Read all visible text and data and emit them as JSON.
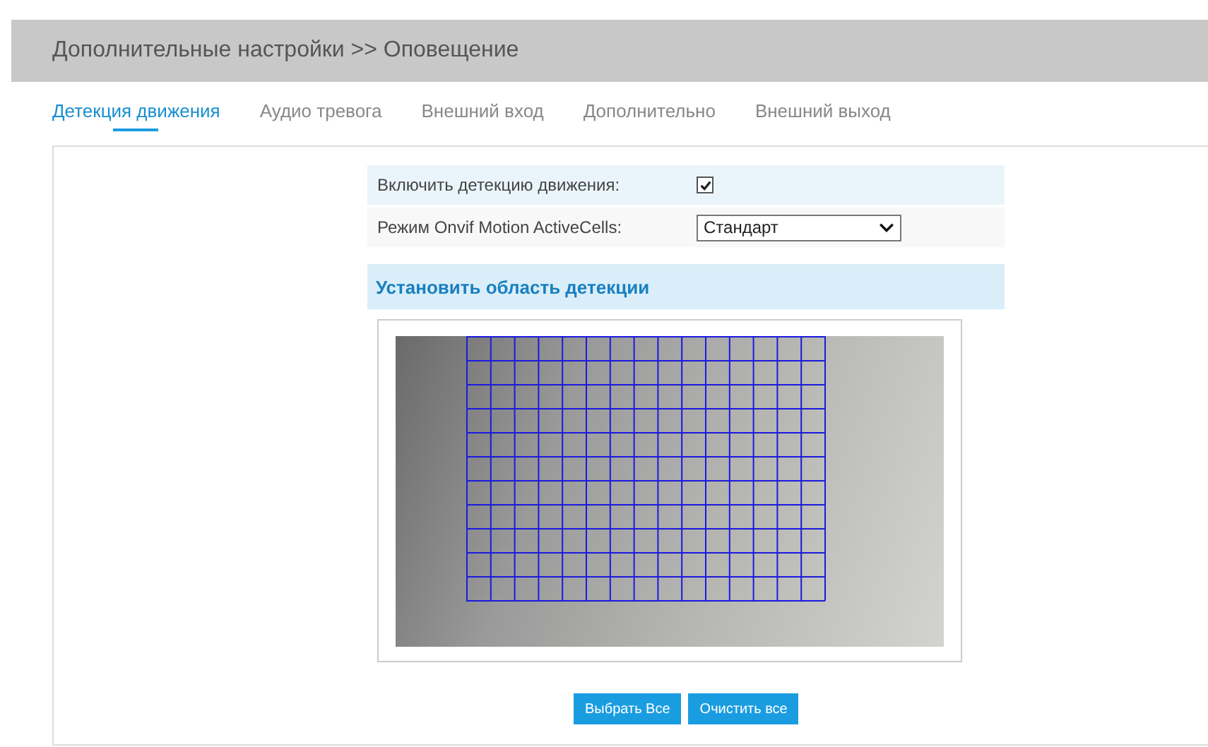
{
  "header": {
    "title": "Дополнительные настройки >> Оповещение"
  },
  "tabs": [
    {
      "label": "Детекция движения",
      "selected": true
    },
    {
      "label": "Аудио тревога",
      "selected": false
    },
    {
      "label": "Внешний вход",
      "selected": false
    },
    {
      "label": "Дополнительно",
      "selected": false
    },
    {
      "label": "Внешний выход",
      "selected": false
    }
  ],
  "settings": [
    {
      "kind": "checkbox",
      "label": "Включить детекцию движения:",
      "checked": true
    },
    {
      "kind": "select",
      "label": "Режим Onvif Motion ActiveCells:",
      "value": "Стандарт"
    }
  ],
  "section": {
    "title": "Установить область детекции"
  },
  "buttons": [
    "Выбрать Все",
    "Очистить все"
  ]
}
